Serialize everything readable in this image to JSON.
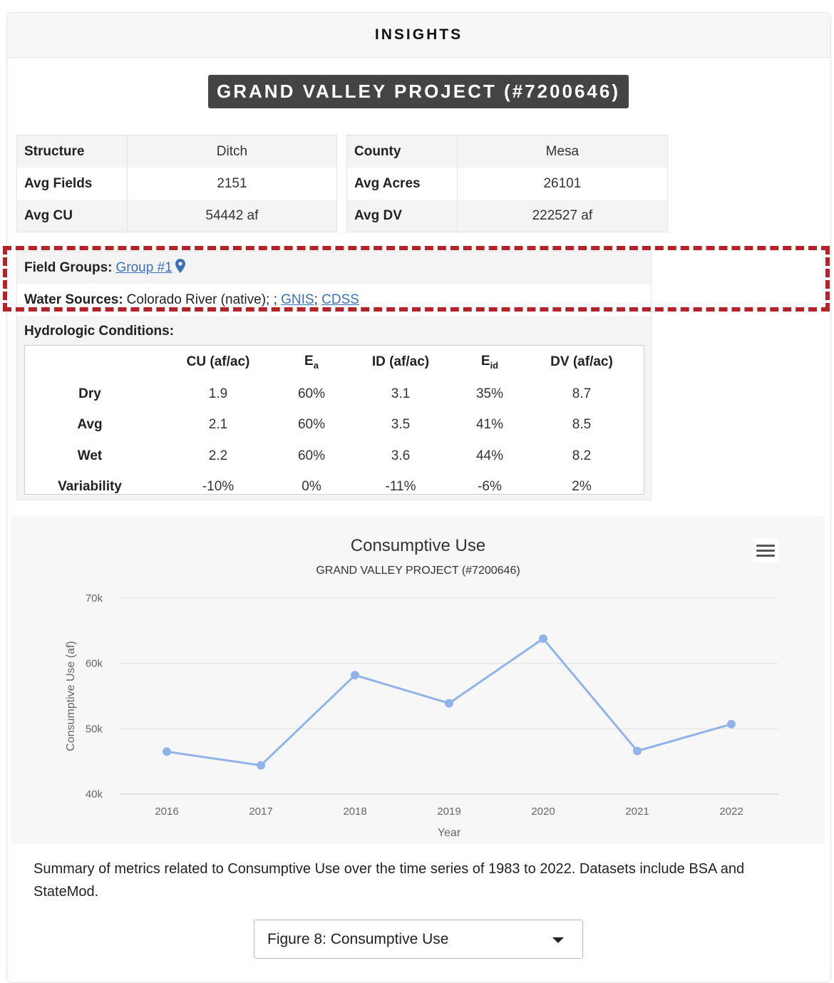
{
  "panel": {
    "header": "INSIGHTS"
  },
  "project_title": "GRAND VALLEY PROJECT (#7200646)",
  "info_left": [
    {
      "label": "Structure",
      "value": "Ditch"
    },
    {
      "label": "Avg Fields",
      "value": "2151"
    },
    {
      "label": "Avg CU",
      "value": "54442 af"
    }
  ],
  "info_right": [
    {
      "label": "County",
      "value": "Mesa"
    },
    {
      "label": "Avg Acres",
      "value": "26101"
    },
    {
      "label": "Avg DV",
      "value": "222527 af"
    }
  ],
  "field_groups": {
    "label": "Field Groups:",
    "link": "Group #1",
    "icon": "map-pin-icon"
  },
  "water_sources": {
    "label": "Water Sources:",
    "text": "Colorado River (native); ;",
    "sep": ";",
    "link1": "GNIS",
    "link2": "CDSS"
  },
  "hydrologic": {
    "label": "Hydrologic Conditions:",
    "headers": [
      "",
      "CU (af/ac)",
      "E",
      "ID (af/ac)",
      "E",
      "DV (af/ac)"
    ],
    "header_subs": [
      "",
      "",
      "a",
      "",
      "id",
      ""
    ],
    "rows": [
      [
        "Dry",
        "1.9",
        "60%",
        "3.1",
        "35%",
        "8.7"
      ],
      [
        "Avg",
        "2.1",
        "60%",
        "3.5",
        "41%",
        "8.5"
      ],
      [
        "Wet",
        "2.2",
        "60%",
        "3.6",
        "44%",
        "8.2"
      ],
      [
        "Variability",
        "-10%",
        "0%",
        "-11%",
        "-6%",
        "2%"
      ]
    ]
  },
  "highlight_color": "#b3232a",
  "chart_data": {
    "type": "line",
    "title": "Consumptive Use",
    "subtitle": "GRAND VALLEY PROJECT (#7200646)",
    "xlabel": "Year",
    "ylabel": "Consumptive Use (af)",
    "categories": [
      "2016",
      "2017",
      "2018",
      "2019",
      "2020",
      "2021",
      "2022"
    ],
    "values": [
      46500,
      44400,
      58200,
      53900,
      63800,
      46600,
      50700
    ],
    "ylim": [
      40000,
      70000
    ],
    "yticks": [
      "40k",
      "50k",
      "60k",
      "70k"
    ],
    "ytick_values": [
      40000,
      50000,
      60000,
      70000
    ],
    "grid": true,
    "color": "#90b4e8"
  },
  "summary": "Summary of metrics related to Consumptive Use over the time series of 1983 to 2022. Datasets include BSA and StateMod.",
  "figure_select": {
    "value": "Figure 8: Consumptive Use"
  }
}
